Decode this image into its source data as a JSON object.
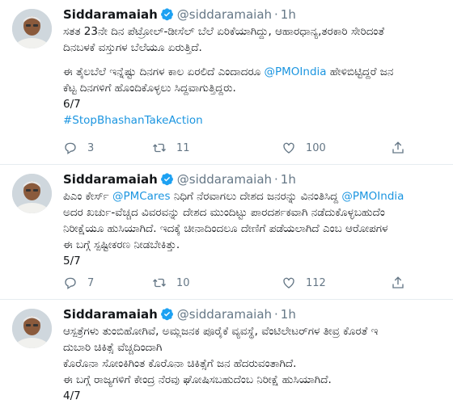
{
  "tweets": [
    {
      "name": "Siddaramaiah",
      "handle": "@siddaramaiah",
      "dot": "·",
      "time": "1h",
      "body": [
        {
          "text": "ಸತತ 23ನೇ ದಿನ ಪೆಟ್ರೋಲ್-ಡೀಸೆಲ್ ಬೆಲೆ ಏರಿಕೆಯಾಗಿದ್ದು, ಆಹಾರಧಾನ್ಯ,ತರಕಾರಿ ಸೇರಿದಂತೆ"
        },
        {
          "text": "ದಿನಬಳಕೆ ವಸ್ತುಗಳ ಬೆಲೆಯೂ ಏರುತ್ತಿದೆ."
        },
        {
          "pre": "ಈ ತೈಲಬೆಲೆ ಇನ್ನೆಷ್ಟು ದಿನಗಳ ಕಾಲ ಏರಲಿದೆ ಎಂದಾದರೂ ",
          "link": "@PMOIndia",
          "post": " ಹೇಳಿಬಿಟ್ಟಿದ್ದರೆ ಜನ"
        },
        {
          "text": "ಕೆಟ್ಟ ದಿನಗಳಿಗೆ ಹೊಂದಿಕೊಳ್ಳಲು ಸಿದ್ದವಾಗುತ್ತಿದ್ದರು."
        },
        {
          "text": "6/7"
        },
        {
          "link": "#StopBhashanTakeAction"
        }
      ],
      "counts": {
        "reply": "3",
        "retweet": "11",
        "like": "100"
      }
    },
    {
      "name": "Siddaramaiah",
      "handle": "@siddaramaiah",
      "dot": "·",
      "time": "1h",
      "body": [
        {
          "pre": "ಪಿಎಂ ಕೇರ್ಸ್ ",
          "link": "@PMCares",
          "mid": " ನಿಧಿಗೆ ನೆರವಾಗಲು ದೇಶದ ಜನರನ್ನು ವಿನಂತಿಸಿದ್ದ ",
          "link2": "@PMOIndia"
        },
        {
          "text": "ಅದರ ಖರ್ಚು-ವೆಚ್ಚದ ವಿವರವನ್ನು ದೇಶದ ಮುಂದಿಟ್ಟು ಪಾರದರ್ಶಕವಾಗಿ ನಡೆದುಕೊಳ್ಳಬಹುದೆಂ"
        },
        {
          "text": "ನಿರೀಕ್ಷೆಯೂ ಹುಸಿಯಾಗಿದೆ. ಇದಕ್ಕೆ ಚೀನಾದಿಂದಲೂ ದೇಣಿಗೆ ಪಡೆಯಲಾಗಿದೆ ಎಂಬ ಆರೋಪಗಳ"
        },
        {
          "text": "ಈ ಬಗ್ಗೆ ಸ್ಪಷ್ಟೀಕರಣ ನೀಡಬೇಕಿತ್ತು."
        },
        {
          "text": "5/7"
        }
      ],
      "counts": {
        "reply": "7",
        "retweet": "10",
        "like": "112"
      }
    },
    {
      "name": "Siddaramaiah",
      "handle": "@siddaramaiah",
      "dot": "·",
      "time": "1h",
      "body": [
        {
          "text": "ಆಸ್ಪತ್ರೆಗಳು ತುಂಬಿಹೋಗಿವೆ, ಅಮ್ಲಜನಕ ಪೂರೈಕೆ ವ್ಯವಸ್ಥೆ, ವೆಂಟಿಲೇಟರ್‌ಗಳ ತೀವ್ರ ಕೊರತೆ ಇ"
        },
        {
          "text": "ದುಬಾರಿ ಚಿಕಿತ್ಸೆ ವೆಚ್ಚದಿಂದಾಗಿ"
        },
        {
          "text": "ಕೊರೊನಾ ಸೋಂಕಿಗಿಂತ ಕೊರೊನಾ ಚಿಕಿತ್ಸೆಗೆ ಜನ ಹೆದರುವಂತಾಗಿದೆ."
        },
        {
          "text": "ಈ ಬಗ್ಗೆ ರಾಜ್ಯಗಳಿಗೆ ಕೇಂದ್ರ ನೆರವು ಘೋಷಿಸಬಹುದೆಂಬ ನಿರೀಕ್ಷೆ ಹುಸಿಯಾಗಿದೆ."
        },
        {
          "text": "4/7"
        }
      ],
      "counts": {
        "reply": "",
        "retweet": "",
        "like": ""
      }
    }
  ],
  "icons": {
    "reply": "reply-icon",
    "retweet": "retweet-icon",
    "like": "heart-icon",
    "share": "share-icon",
    "verified": "verified-badge-icon"
  },
  "colors": {
    "link": "#1b95e0",
    "muted": "#657786",
    "verified": "#1da1f2",
    "divider": "#e6ecf0"
  }
}
